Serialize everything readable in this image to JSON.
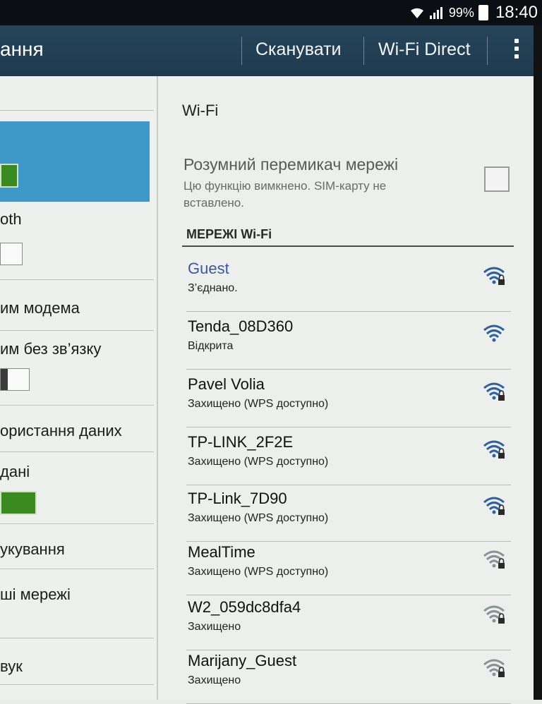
{
  "status_bar": {
    "battery": "99%",
    "time": "18:40"
  },
  "action_bar": {
    "title": "ання",
    "scan_label": "Сканувати",
    "wifi_direct_label": "Wi-Fi Direct"
  },
  "left_pane": {
    "items": [
      {
        "label": "oth"
      },
      {
        "label": "им модема"
      },
      {
        "label": "им без зв’язку"
      },
      {
        "label": "ористання даних"
      },
      {
        "label": "дані"
      },
      {
        "label": "укування"
      },
      {
        "label": "ші мережі"
      },
      {
        "label": "вук"
      }
    ]
  },
  "main": {
    "header": "Wi-Fi",
    "smart_switch": {
      "title": "Розумний перемикач мережі",
      "description": "Цю функцію вимкнено. SIM-карту не вставлено."
    },
    "networks_title": "МЕРЕЖІ Wi-Fi",
    "networks": [
      {
        "name": "Guest",
        "status": "З’єднано."
      },
      {
        "name": "Tenda_08D360",
        "status": "Відкрита"
      },
      {
        "name": "Pavel Volia",
        "status": "Захищено (WPS доступно)"
      },
      {
        "name": "TP-LINK_2F2E",
        "status": "Захищено (WPS доступно)"
      },
      {
        "name": "TP-Link_7D90",
        "status": "Захищено (WPS доступно)"
      },
      {
        "name": "MealTime",
        "status": "Захищено (WPS доступно)"
      },
      {
        "name": "W2_059dc8dfa4",
        "status": "Захищено"
      },
      {
        "name": "Marijany_Guest",
        "status": "Захищено"
      }
    ]
  },
  "colors": {
    "accent": "#3e99c8",
    "actionbar": "#1e3a4e",
    "connected_name": "#3a58a2",
    "signal_strong": "#2b5fa6",
    "signal_weak": "#8a9096"
  }
}
